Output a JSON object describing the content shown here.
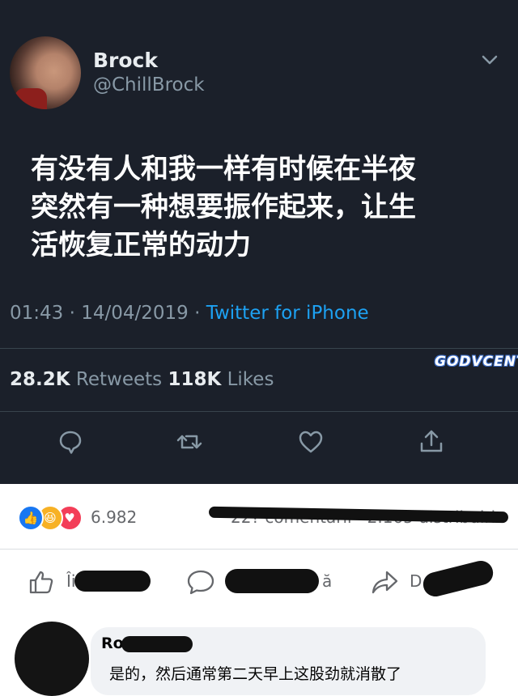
{
  "tweet": {
    "name": "Brock",
    "handle": "@ChillBrock",
    "lines": [
      "有没有人和我一样有时候在半夜",
      "突然有一种想要振作起来，让生",
      "活恢复正常的动力"
    ],
    "timestamp": "01:43 · 14/04/2019 · ",
    "source": "Twitter for iPhone",
    "retweets_count": "28.2K",
    "retweets_label": "Retweets",
    "likes_count": "118K",
    "likes_label": "Likes",
    "watermark": "GODVCENT"
  },
  "facebook": {
    "reaction_count": "6.982",
    "comments_visible": "22? comentarii · 2.165 distribuiri",
    "like_partial": "Îi",
    "comment_partial": "ă",
    "share_partial": "D",
    "comment_author_partial": "Ro",
    "comment_text": "是的，然后通常第二天早上这股劲就消散了"
  },
  "colors": {
    "twitter_bg": "#1b202a",
    "twitter_blue": "#1da1f2",
    "fb_like": "#1877f2",
    "fb_love": "#f33e58",
    "fb_haha": "#f7b125"
  }
}
